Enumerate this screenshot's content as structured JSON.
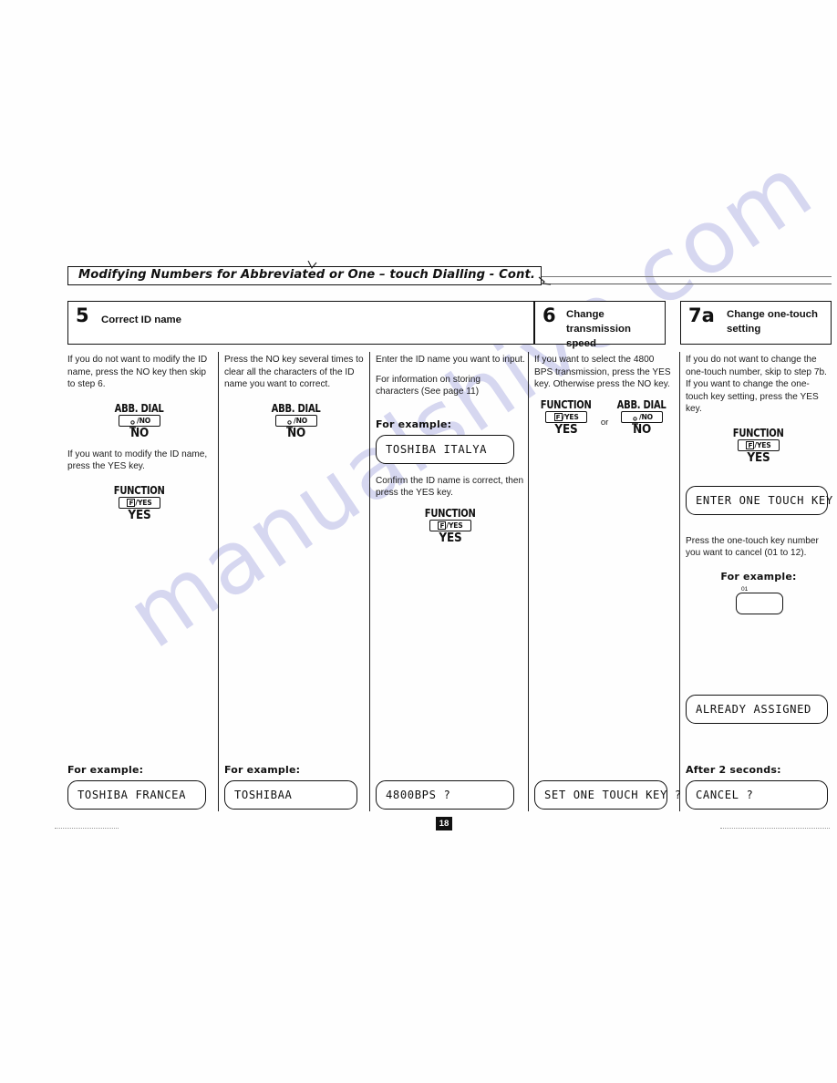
{
  "watermark": {
    "text": "manualshive.com"
  },
  "header": {
    "title": "Modifying Numbers for Abbreviated or One – touch Dialling - Cont."
  },
  "page_number": "18",
  "keys": {
    "abb_dial": {
      "caption": "ABB. DIAL",
      "cap_text": "/NO",
      "word": "NO",
      "icon": "abbreviated-dial-icon"
    },
    "function": {
      "caption": "FUNCTION",
      "cap_glyph": "F",
      "cap_text": "/YES",
      "word": "YES",
      "icon": "function-key-icon"
    }
  },
  "steps": [
    {
      "number": "5",
      "label": "Correct ID name"
    },
    {
      "number": "6",
      "label": "Change transmission speed"
    },
    {
      "number": "7a",
      "label": "Change one-touch setting"
    }
  ],
  "columns": [
    {
      "id": "col-1",
      "paragraphs": [
        "If you do not want to modify the ID name, press the NO key then skip to step 6.",
        "If you want to modify the ID name, press the YES key."
      ],
      "example_label": "For example:",
      "display": "TOSHIBA FRANCEA"
    },
    {
      "id": "col-2",
      "paragraphs": [
        "Press the NO key several times to clear all the characters of the ID name you want to correct."
      ],
      "example_label": "For example:",
      "display": "TOSHIBAA"
    },
    {
      "id": "col-3",
      "paragraphs": [
        "Enter the ID name you want to input.",
        "For information on storing characters (See page 11)",
        "Confirm the ID name is correct, then press the YES key."
      ],
      "example_label": "For example:",
      "example_display": "TOSHIBA ITALYA",
      "display": "4800BPS ?"
    },
    {
      "id": "col-4",
      "paragraphs": [
        "If you want to select the 4800 BPS transmission, press the YES key.  Otherwise press the NO key."
      ],
      "or_word": "or",
      "display": "SET ONE TOUCH KEY ?"
    },
    {
      "id": "col-5",
      "paragraphs": [
        "If you do not want to change the one-touch number, skip to step 7b.",
        "If you want to change the one-touch key setting, press the YES key.",
        "Press the one-touch key number you want to cancel (01 to 12)."
      ],
      "display_enter": "ENTER ONE TOUCH KEY",
      "example_label": "For example:",
      "onetouch_number": "01",
      "display_assigned": "ALREADY ASSIGNED",
      "after_label": "After 2 seconds:",
      "display": "CANCEL ?"
    }
  ]
}
